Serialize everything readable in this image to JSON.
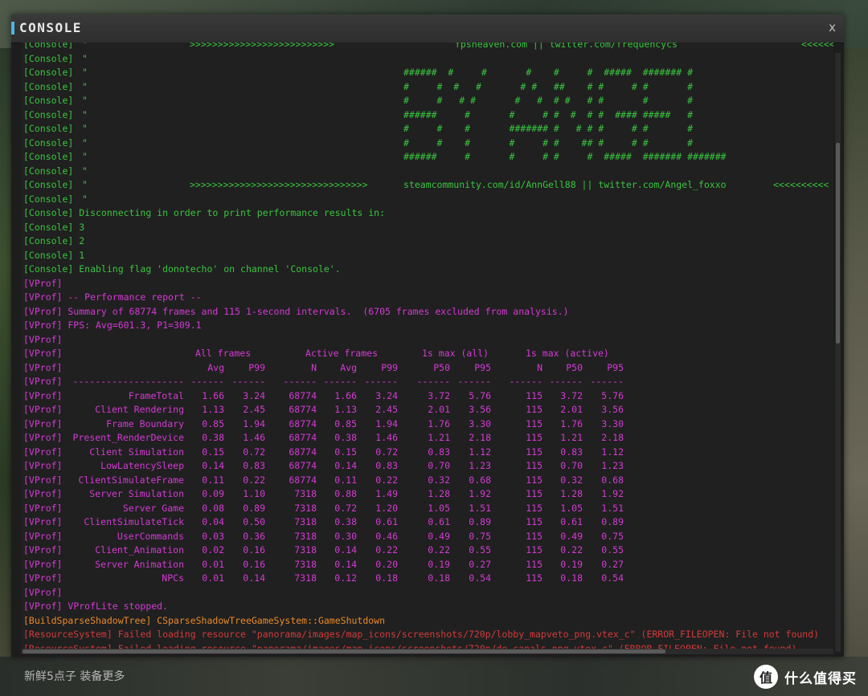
{
  "window": {
    "title": "CONSOLE",
    "close_label": "x"
  },
  "background": {
    "bottom_text": "新鲜5点子 装备更多"
  },
  "watermark": {
    "logo": "值",
    "text": "什么值得买"
  },
  "colors": {
    "console_green": "#39c43f",
    "vprof_magenta": "#d43ad4",
    "build_orange": "#e88a2a",
    "error_red": "#d23a3a"
  },
  "header": [
    {
      "tag": "[Console]",
      "q": "\"",
      "a": ">>>>>>>>>>>>>>>>>>>>>>>>>>",
      "b": "fpsheaven.com || twitter.com/frequencycs",
      "c": "<<<<<<"
    },
    {
      "tag": "[Console]",
      "q": "\"",
      "a": "",
      "b": "",
      "c": ""
    },
    {
      "tag": "[Console]",
      "q": "\"",
      "a": "",
      "b": "######  #     #       #    #     #  #####  ####### #",
      "c": ""
    },
    {
      "tag": "[Console]",
      "q": "\"",
      "a": "",
      "b": "#     #  #   #       # #   ##    # #     # #       #",
      "c": ""
    },
    {
      "tag": "[Console]",
      "q": "\"",
      "a": "",
      "b": "#     #   # #       #   #  # #   # #       #       #",
      "c": ""
    },
    {
      "tag": "[Console]",
      "q": "\"",
      "a": "",
      "b": "######     #       #     # #  #  # #  #### #####   #",
      "c": ""
    },
    {
      "tag": "[Console]",
      "q": "\"",
      "a": "",
      "b": "#     #    #       ####### #   # # #     # #       #",
      "c": ""
    },
    {
      "tag": "[Console]",
      "q": "\"",
      "a": "",
      "b": "#     #    #       #     # #    ## #     # #       #",
      "c": ""
    },
    {
      "tag": "[Console]",
      "q": "\"",
      "a": "",
      "b": "######     #       #     # #     #  #####  ####### #######",
      "c": ""
    },
    {
      "tag": "[Console]",
      "q": "\"",
      "a": "",
      "b": "",
      "c": ""
    },
    {
      "tag": "[Console]",
      "q": "\"",
      "a": ">>>>>>>>>>>>>>>>>>>>>>>>>>>>>>>>",
      "b": "steamcommunity.com/id/AnnGell88 || twitter.com/Angel_foxxo",
      "c": "<<<<<<<<<<"
    },
    {
      "tag": "[Console]",
      "q": "\"",
      "a": "",
      "b": "",
      "c": ""
    }
  ],
  "console_msgs": [
    "[Console] Disconnecting in order to print performance results in:",
    "[Console] 3",
    "[Console] 2",
    "[Console] 1",
    "[Console] Enabling flag 'donotecho' on channel 'Console'."
  ],
  "vprof_intro": [
    "[VProf]",
    "[VProf] -- Performance report --",
    "[VProf] Summary of 68774 frames and 115 1-second intervals.  (6705 frames excluded from analysis.)",
    "[VProf] FPS: Avg=601.3, P1=309.1",
    "[VProf]"
  ],
  "table": {
    "tag": "[VProf]",
    "groups": [
      "All frames",
      "Active frames",
      "1s max (all)",
      "1s max (active)"
    ],
    "columns": [
      "Avg",
      "P99",
      "N",
      "Avg",
      "P99",
      "P50",
      "P95",
      "N",
      "P50",
      "P95"
    ],
    "separator": [
      "--------------------",
      "------",
      "------",
      "------",
      "------",
      "------",
      "------",
      "------",
      "------",
      "------",
      "------"
    ],
    "rows": [
      [
        "FrameTotal",
        "1.66",
        "3.24",
        "68774",
        "1.66",
        "3.24",
        "3.72",
        "5.76",
        "115",
        "3.72",
        "5.76"
      ],
      [
        "Client Rendering",
        "1.13",
        "2.45",
        "68774",
        "1.13",
        "2.45",
        "2.01",
        "3.56",
        "115",
        "2.01",
        "3.56"
      ],
      [
        "Frame Boundary",
        "0.85",
        "1.94",
        "68774",
        "0.85",
        "1.94",
        "1.76",
        "3.30",
        "115",
        "1.76",
        "3.30"
      ],
      [
        "Present_RenderDevice",
        "0.38",
        "1.46",
        "68774",
        "0.38",
        "1.46",
        "1.21",
        "2.18",
        "115",
        "1.21",
        "2.18"
      ],
      [
        "Client Simulation",
        "0.15",
        "0.72",
        "68774",
        "0.15",
        "0.72",
        "0.83",
        "1.12",
        "115",
        "0.83",
        "1.12"
      ],
      [
        "LowLatencySleep",
        "0.14",
        "0.83",
        "68774",
        "0.14",
        "0.83",
        "0.70",
        "1.23",
        "115",
        "0.70",
        "1.23"
      ],
      [
        "ClientSimulateFrame",
        "0.11",
        "0.22",
        "68774",
        "0.11",
        "0.22",
        "0.32",
        "0.68",
        "115",
        "0.32",
        "0.68"
      ],
      [
        "Server Simulation",
        "0.09",
        "1.10",
        "7318",
        "0.88",
        "1.49",
        "1.28",
        "1.92",
        "115",
        "1.28",
        "1.92"
      ],
      [
        "Server Game",
        "0.08",
        "0.89",
        "7318",
        "0.72",
        "1.20",
        "1.05",
        "1.51",
        "115",
        "1.05",
        "1.51"
      ],
      [
        "ClientSimulateTick",
        "0.04",
        "0.50",
        "7318",
        "0.38",
        "0.61",
        "0.61",
        "0.89",
        "115",
        "0.61",
        "0.89"
      ],
      [
        "UserCommands",
        "0.03",
        "0.36",
        "7318",
        "0.30",
        "0.46",
        "0.49",
        "0.75",
        "115",
        "0.49",
        "0.75"
      ],
      [
        "Client_Animation",
        "0.02",
        "0.16",
        "7318",
        "0.14",
        "0.22",
        "0.22",
        "0.55",
        "115",
        "0.22",
        "0.55"
      ],
      [
        "Server Animation",
        "0.01",
        "0.16",
        "7318",
        "0.14",
        "0.20",
        "0.19",
        "0.27",
        "115",
        "0.19",
        "0.27"
      ],
      [
        "NPCs",
        "0.01",
        "0.14",
        "7318",
        "0.12",
        "0.18",
        "0.18",
        "0.54",
        "115",
        "0.18",
        "0.54"
      ]
    ]
  },
  "vprof_outro": [
    "[VProf]",
    "[VProf] VProfLite stopped."
  ],
  "build_msg": "[BuildSparseShadowTree] CSparseShadowTreeGameSystem::GameShutdown",
  "errors": [
    "[ResourceSystem] Failed loading resource \"panorama/images/map_icons/screenshots/720p/lobby_mapveto_png.vtex_c\" (ERROR_FILEOPEN: File not found)",
    "[ResourceSystem] Failed loading resource \"panorama/images/map_icons/screenshots/720p/de_canals_png.vtex_c\" (ERROR_FILEOPEN: File not found)"
  ]
}
